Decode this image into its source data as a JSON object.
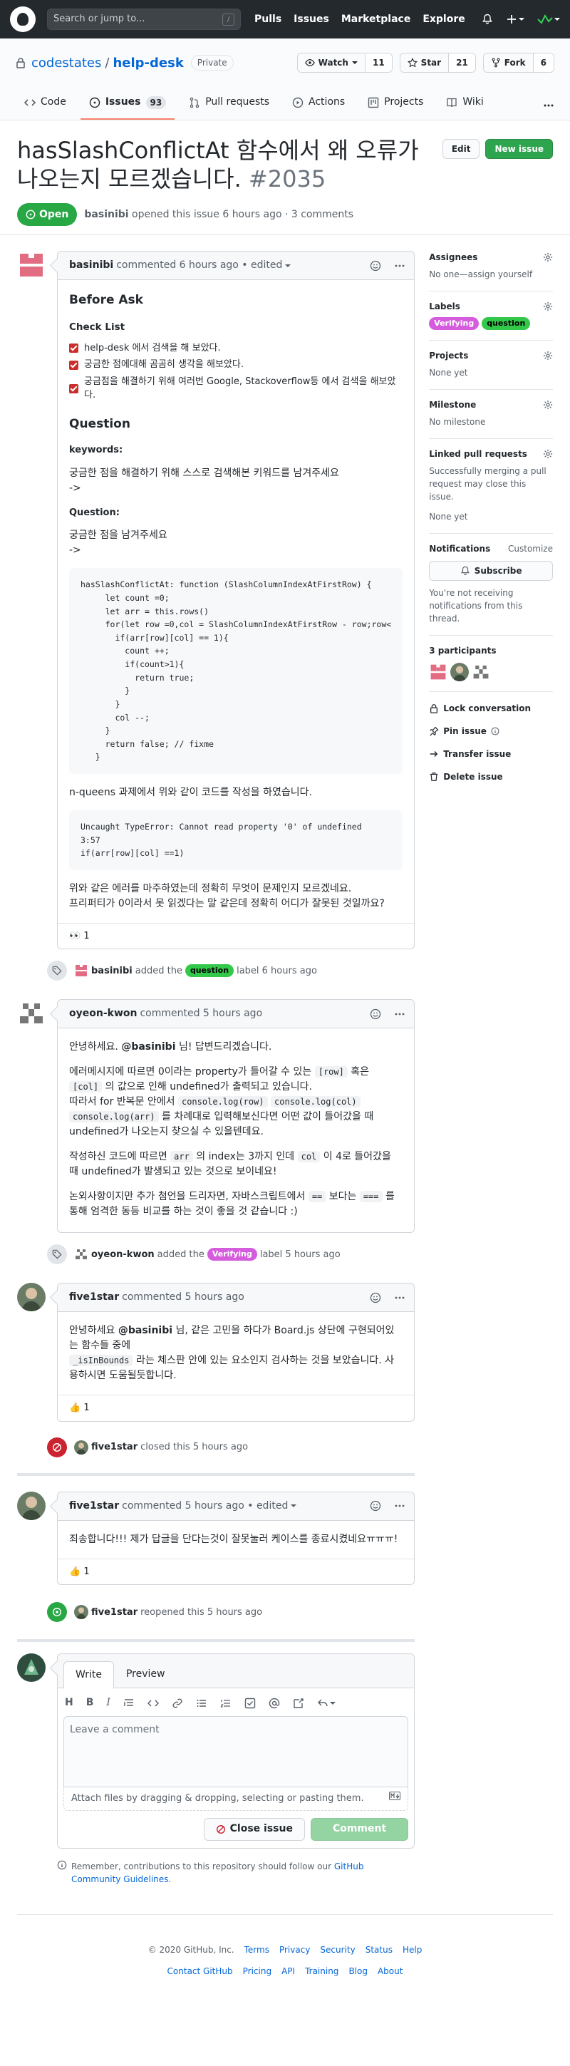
{
  "topbar": {
    "search_placeholder": "Search or jump to...",
    "search_key": "/",
    "nav": [
      "Pulls",
      "Issues",
      "Marketplace",
      "Explore"
    ]
  },
  "repo": {
    "owner": "codestates",
    "name": "help-desk",
    "visibility": "Private",
    "watch_label": "Watch",
    "watch_count": "11",
    "star_label": "Star",
    "star_count": "21",
    "fork_label": "Fork",
    "fork_count": "6",
    "tabs": [
      {
        "label": "Code"
      },
      {
        "label": "Issues",
        "count": "93"
      },
      {
        "label": "Pull requests"
      },
      {
        "label": "Actions"
      },
      {
        "label": "Projects"
      },
      {
        "label": "Wiki"
      }
    ]
  },
  "issue": {
    "title": "hasSlashConflictAt 함수에서 왜 오류가 나오는지 모르겠습니다.",
    "number": "#2035",
    "edit_label": "Edit",
    "new_issue_label": "New issue",
    "state": "Open",
    "author": "basinibi",
    "meta": "opened this issue 6 hours ago · 3 comments"
  },
  "comments": {
    "first": {
      "author": "basinibi",
      "meta": "commented 6 hours ago • edited",
      "h_before": "Before Ask",
      "h_checklist": "Check List",
      "checklist": [
        "help-desk 에서 검색을 해 보았다.",
        "궁금한 점에대해 곰곰히 생각을 해보았다.",
        "궁금점을 해결하기 위해 여러번 Google, Stackoverflow등 에서 검색을 해보았다."
      ],
      "h_question": "Question",
      "keywords_label": "keywords:",
      "keywords_text": "궁금한 점을 해결하기 위해 스스로 검색해본 키워드를 남겨주세요",
      "arrow": "->",
      "question_label": "Question:",
      "question_text": "궁금한 점을 남겨주세요",
      "code": "hasSlashConflictAt: function (SlashColumnIndexAtFirstRow) {\n     let count =0;\n     let arr = this.rows()\n     for(let row =0,col = SlashColumnIndexAtFirstRow - row;row<\n       if(arr[row][col] == 1){\n         count ++;\n         if(count>1){\n           return true;\n         }\n       }\n       col --;\n     }\n     return false; // fixme\n   }",
      "after_code": "n-queens 과제에서 위와 같이 코드를 작성을 하였습니다.",
      "error_code": "Uncaught TypeError: Cannot read property '0' of undefined\n3:57\nif(arr[row][col] ==1)",
      "closing_1": "위와 같은 에러를 마주하였는데 정확히 무엇이 문제인지 모르겠네요.",
      "closing_2": "프리퍼티가 0이라서 못 읽겠다는 말 같은데 정확히 어디가 잘못된 것일까요?",
      "reaction_emoji": "👀",
      "reaction_count": "1"
    },
    "event_label_question": {
      "actor": "basinibi",
      "text_before": "added the",
      "label": "question",
      "text_after": "label 6 hours ago"
    },
    "second": {
      "author": "oyeon-kwon",
      "meta": "commented 5 hours ago",
      "p1_pre": "안녕하세요.",
      "p1_mention": "@basinibi",
      "p1_post": "님! 답변드리겠습니다.",
      "p2_a": "에러메시지에 따르면 0이라는 property가 들어갈 수 있는",
      "p2_code1": "[row]",
      "p2_b": "혹은",
      "p2_code2": "[col]",
      "p2_c": "의 값으로 인해 undefined가 출력되고 있습니다.",
      "p2_d": "따라서 for 반복문 안에서",
      "p2_code3": "console.log(row)",
      "p2_code4": "console.log(col)",
      "p2_code5": "console.log(arr)",
      "p2_e": "를 차례대로 입력해보신다면 어떤 값이 들어갔을 때 undefined가 나오는지 찾으실 수 있을텐데요.",
      "p3_a": "작성하신 코드에 따르면",
      "p3_code1": "arr",
      "p3_b": "의 index는 3까지 인데",
      "p3_code2": "col",
      "p3_c": "이 4로 들어갔을 때 undefined가 발생되고 있는 것으로 보이네요!",
      "p4_a": "논외사항이지만 추가 첨언을 드리자면, 자바스크립트에서",
      "p4_code1": "==",
      "p4_b": "보다는",
      "p4_code2": "===",
      "p4_c": "를 통해 엄격한 동등 비교를 하는 것이 좋을 것 같습니다 :)"
    },
    "event_label_verifying": {
      "actor": "oyeon-kwon",
      "text_before": "added the",
      "label": "Verifying",
      "text_after": "label 5 hours ago"
    },
    "third": {
      "author": "five1star",
      "meta": "commented 5 hours ago",
      "p_pre": "안녕하세요",
      "p_mention": "@basinibi",
      "p_mid": "님, 같은 고민을 하다가 Board.js 상단에 구현되어있는 함수들 중에",
      "p_code": "_isInBounds",
      "p_post": "라는 체스판 안에 있는 요소인지 검사하는 것을 보았습니다. 사용하시면 도움될듯합니다.",
      "reaction_emoji": "👍",
      "reaction_count": "1"
    },
    "event_closed": {
      "actor": "five1star",
      "text": "closed this 5 hours ago"
    },
    "fourth": {
      "author": "five1star",
      "meta": "commented 5 hours ago • edited",
      "p": "죄송합니다!!! 제가 답글을 단다는것이 잘못눌러 케이스를 종료시켰네요ㅠㅠㅠ!",
      "reaction_emoji": "👍",
      "reaction_count": "1"
    },
    "event_reopened": {
      "actor": "five1star",
      "text": "reopened this 5 hours ago"
    }
  },
  "editor": {
    "tab_write": "Write",
    "tab_preview": "Preview",
    "toolbar": [
      "H",
      "B",
      "I"
    ],
    "placeholder": "Leave a comment",
    "attach_hint": "Attach files by dragging & dropping, selecting or pasting them.",
    "close_issue": "Close issue",
    "comment": "Comment",
    "tip_pre": "Remember, contributions to this repository should follow our",
    "tip_link": "GitHub Community Guidelines",
    "tip_post": "."
  },
  "sidebar": {
    "assignees_title": "Assignees",
    "assignees_value": "No one—assign yourself",
    "labels_title": "Labels",
    "labels": [
      {
        "name": "Verifying",
        "color": "#d55ddd"
      },
      {
        "name": "question",
        "color": "#32c84a"
      }
    ],
    "projects_title": "Projects",
    "projects_value": "None yet",
    "milestone_title": "Milestone",
    "milestone_value": "No milestone",
    "linked_title": "Linked pull requests",
    "linked_desc": "Successfully merging a pull request may close this issue.",
    "linked_value": "None yet",
    "notifications_title": "Notifications",
    "notifications_customize": "Customize",
    "subscribe_label": "Subscribe",
    "notifications_desc": "You're not receiving notifications from this thread.",
    "participants_title": "3 participants",
    "lock": "Lock conversation",
    "pin": "Pin issue",
    "transfer": "Transfer issue",
    "delete": "Delete issue"
  },
  "footer": {
    "copyright": "© 2020 GitHub, Inc.",
    "row1": [
      "Terms",
      "Privacy",
      "Security",
      "Status",
      "Help"
    ],
    "row2": [
      "Contact GitHub",
      "Pricing",
      "API",
      "Training",
      "Blog",
      "About"
    ]
  },
  "colors": {
    "header_bg": "#24292e",
    "open_green": "#28a745",
    "closed_red": "#cb2431",
    "link_blue": "#0366d6",
    "tab_accent": "#f9826c"
  }
}
